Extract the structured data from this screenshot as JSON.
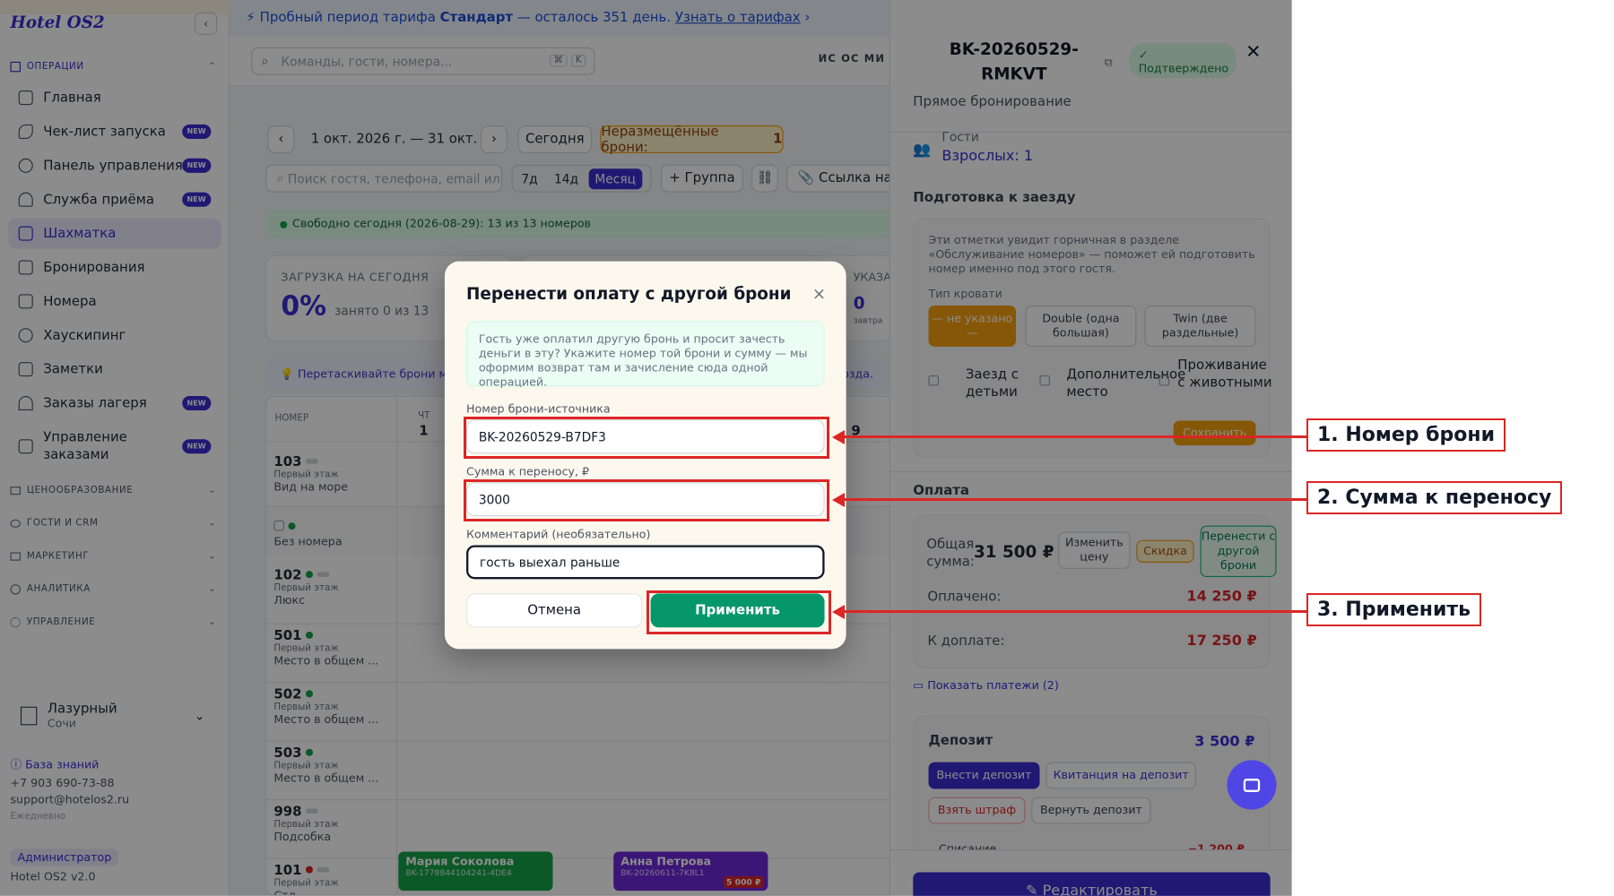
{
  "sidebar": {
    "logo": "Hotel OS2",
    "collapse": "‹",
    "operations_label": "ОПЕРАЦИИ",
    "items": [
      {
        "label": "Главная",
        "badge": ""
      },
      {
        "label": "Чек-лист запуска",
        "badge": "NEW"
      },
      {
        "label": "Панель управления",
        "badge": "NEW"
      },
      {
        "label": "Служба приёма",
        "badge": "NEW"
      },
      {
        "label": "Шахматка",
        "badge": ""
      },
      {
        "label": "Бронирования",
        "badge": ""
      },
      {
        "label": "Номера",
        "badge": ""
      },
      {
        "label": "Хаускипинг",
        "badge": ""
      },
      {
        "label": "Заметки",
        "badge": ""
      },
      {
        "label": "Заказы лагеря",
        "badge": "NEW"
      },
      {
        "label": "Управление заказами",
        "badge": "NEW"
      }
    ],
    "sections": [
      "ЦЕНООБРАЗОВАНИЕ",
      "ГОСТИ И CRM",
      "МАРКЕТИНГ",
      "АНАЛИТИКА",
      "УПРАВЛЕНИЕ"
    ],
    "hotel_name": "Лазурный",
    "hotel_city": "Сочи",
    "knowledge_base": "База знаний",
    "phone": "+7 903 690-73-88",
    "email": "support@hotelos2.ru",
    "hours": "Ежедневно",
    "role": "Администратор",
    "version": "Hotel OS2 v2.0"
  },
  "banner": {
    "prefix": "Пробный период тарифа ",
    "plan": "Стандарт",
    "suffix": " — осталось 351 день.",
    "link": "Узнать о тарифах",
    "arrow": "›"
  },
  "topbar": {
    "search_placeholder": "Команды, гости, номера...",
    "kbd1": "⌘",
    "kbd2": "K",
    "avatars": "ИС ОС МИ АК"
  },
  "calendar": {
    "prev": "‹",
    "next": "›",
    "range": "1 окт. 2026 г. — 31 окт.",
    "today": "Сегодня",
    "unplaced_label": "Неразмещённые брони:",
    "unplaced_count": "1",
    "guest_search": "Поиск гостя, телефона, email или",
    "view_7": "7д",
    "view_14": "14д",
    "view_month": "Месяц",
    "group": "+ Группа",
    "link_btn": "Ссылка на бр",
    "free_today": "Свободно сегодня (2026-08-29): 13 из 13 номеров",
    "load_title": "ЗАГРУЗКА НА СЕГОДНЯ",
    "load_value": "0%",
    "load_sub": "занято 0 из 13",
    "right_title": "УКАЗА",
    "right_value": "0",
    "right_sub": "завтра",
    "drag_tip": "Перетаскивайте брони ме",
    "drag_tip_end": "озда.",
    "col_room": "НОМЕР",
    "col_day1": "ЧТ",
    "col_day1_num": "1",
    "col_day_end": "9",
    "rooms": [
      {
        "num": "103",
        "floor": "Первый этаж",
        "type": "Вид на море"
      },
      {
        "num": "",
        "floor": "",
        "type": "Без номера"
      },
      {
        "num": "102",
        "floor": "Первый этаж",
        "type": "Люкс"
      },
      {
        "num": "501",
        "floor": "Первый этаж",
        "type": "Место в общем ..."
      },
      {
        "num": "502",
        "floor": "Первый этаж",
        "type": "Место в общем ..."
      },
      {
        "num": "503",
        "floor": "Первый этаж",
        "type": "Место в общем ..."
      },
      {
        "num": "998",
        "floor": "Первый этаж",
        "type": "Подсобка"
      },
      {
        "num": "101",
        "floor": "Первый этаж",
        "type": "Стд"
      }
    ],
    "booking1_name": "Мария Соколова",
    "booking1_id": "BK-1778844104241-4DE4",
    "booking2_name": "Анна Петрова",
    "booking2_id": "BK-20260611-7K8L1",
    "booking2_amount": "5 000 ₽"
  },
  "panel": {
    "booking_id": "BK-20260529-RMKVT",
    "status": "Подтверждено",
    "close": "✕",
    "subtitle": "Прямое бронирование",
    "guests_label": "Гости",
    "guests_value": "Взрослых: 1",
    "prep_title": "Подготовка к заезду",
    "prep_note": "Эти отметки увидит горничная в разделе «Обслуживание номеров» — поможет ей подготовить номер именно под этого гостя.",
    "bed_label": "Тип кровати",
    "bed_options": [
      "— не указано —",
      "Double (одна большая)",
      "Twin (две раздельные)"
    ],
    "check_children": "Заезд с детьми",
    "check_extra": "Дополнительное место",
    "check_pets": "Проживание с животными",
    "save": "Сохранить",
    "payment_title": "Оплата",
    "total_label": "Общая сумма:",
    "total_value": "31 500 ₽",
    "change_price": "Изменить цену",
    "discount": "Скидка",
    "transfer": "Перенести с другой брони",
    "paid_label": "Оплачено:",
    "paid_value": "14 250 ₽",
    "due_label": "К доплате:",
    "due_value": "17 250 ₽",
    "show_payments": "Показать платежи (2)",
    "deposit_label": "Депозит",
    "deposit_value": "3 500 ₽",
    "deposit_in": "Внести депозит",
    "deposit_receipt": "Квитанция на депозит",
    "fine": "Взять штраф",
    "deposit_return": "Вернуть депозит",
    "writeoff_label": "Списание",
    "writeoff_value": "−1 200 ₽",
    "edit": "Редактировать"
  },
  "dialog": {
    "title": "Перенести оплату с другой брони",
    "close": "×",
    "info": "Гость уже оплатил другую бронь и просит зачесть деньги в эту? Укажите номер той брони и сумму — мы оформим возврат там и зачисление сюда одной операцией.",
    "source_label": "Номер брони-источника",
    "source_value": "BK-20260529-B7DF3",
    "amount_label": "Сумма к переносу, ₽",
    "amount_value": "3000",
    "comment_label": "Комментарий (необязательно)",
    "comment_value": "гость выехал раньше",
    "cancel": "Отмена",
    "apply": "Применить"
  },
  "annotations": {
    "step1": "1. Номер брони",
    "step2": "2. Сумма к переносу",
    "step3": "3. Применить",
    "color": "#dc2626"
  },
  "colors": {
    "accent": "#3b2ed4",
    "apply": "#059669",
    "danger": "#dc2626",
    "success_bg": "#dcfce7"
  }
}
